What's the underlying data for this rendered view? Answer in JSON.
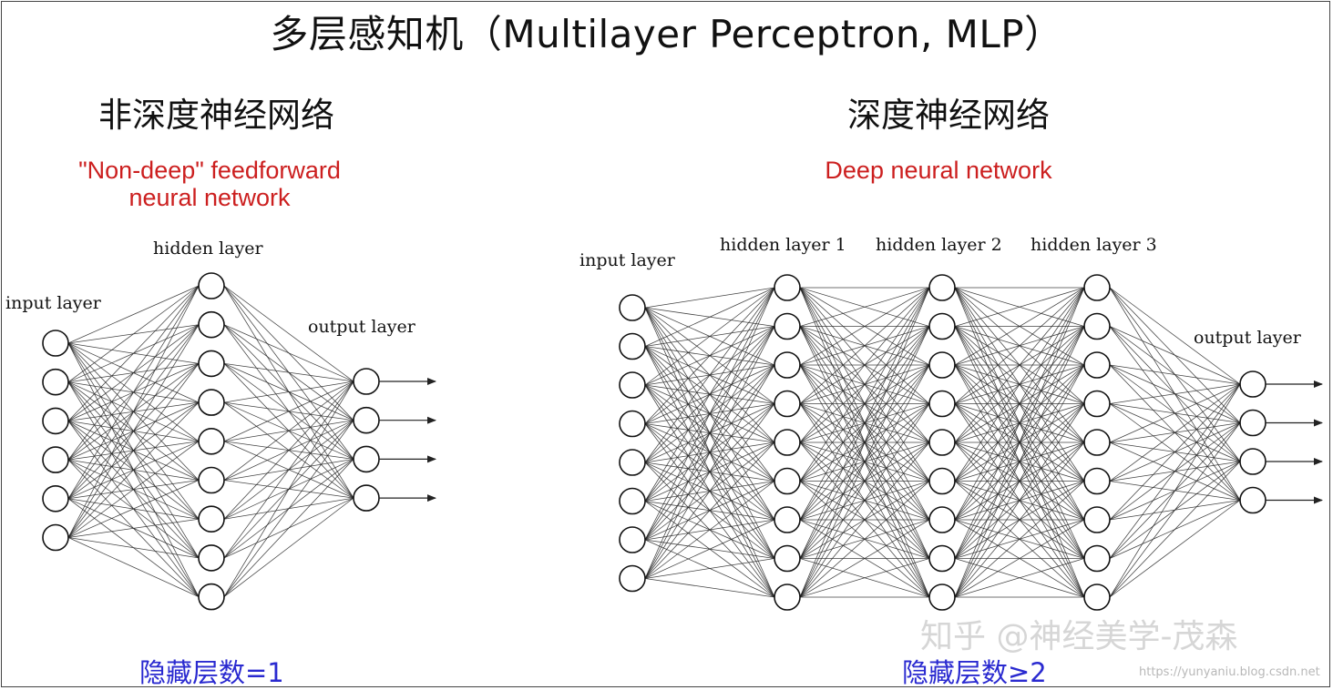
{
  "title": "多层感知机（Multilayer Perceptron, MLP）",
  "left": {
    "heading_zh": "非深度神经网络",
    "heading_en_line1": "\"Non-deep\" feedforward",
    "heading_en_line2": "neural network",
    "caption": "隐藏层数=1",
    "layers": [
      {
        "label": "input layer",
        "neurons": 6
      },
      {
        "label": "hidden layer",
        "neurons": 9
      },
      {
        "label": "output layer",
        "neurons": 4
      }
    ]
  },
  "right": {
    "heading_zh": "深度神经网络",
    "heading_en": "Deep neural network",
    "caption": "隐藏层数≥2",
    "layers": [
      {
        "label": "input layer",
        "neurons": 8
      },
      {
        "label": "hidden layer 1",
        "neurons": 9
      },
      {
        "label": "hidden layer 2",
        "neurons": 9
      },
      {
        "label": "hidden layer 3",
        "neurons": 9
      },
      {
        "label": "output layer",
        "neurons": 4
      }
    ]
  },
  "watermark": "知乎 @神经美学-茂森",
  "watermark_url": "https://yunyaniu.blog.csdn.net",
  "colors": {
    "red": "#cc1f1f",
    "blue": "#2a2ad0",
    "edge": "#222222"
  }
}
